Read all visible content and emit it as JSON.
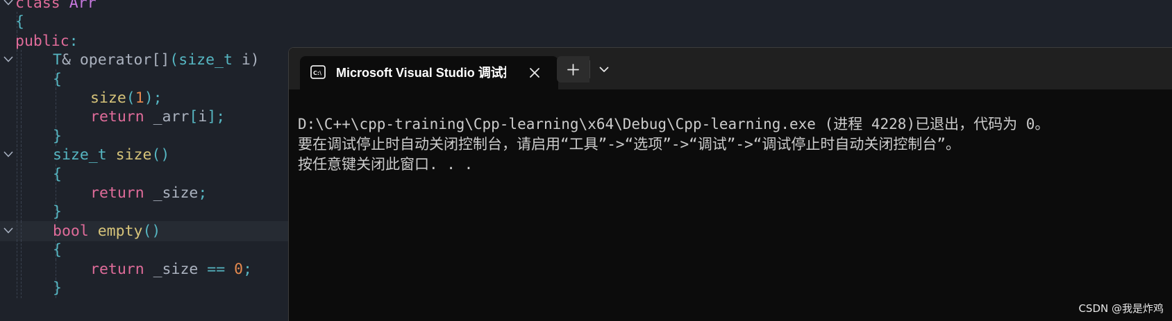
{
  "editor": {
    "lines": [
      {
        "tokens": [
          [
            "class",
            "tok-class"
          ],
          [
            " ",
            ""
          ],
          [
            "Arr",
            "tok-cls-name"
          ]
        ]
      },
      {
        "tokens": [
          [
            "{",
            "tok-punc"
          ]
        ]
      },
      {
        "tokens": [
          [
            "public",
            "tok-kw"
          ],
          [
            ":",
            "tok-punc"
          ]
        ]
      },
      {
        "tokens": [
          [
            "T",
            "tok-type"
          ],
          [
            "& ",
            "tok-plain"
          ],
          [
            "operator",
            "tok-plain"
          ],
          [
            "[]",
            "tok-plain"
          ],
          [
            "(",
            "tok-punc"
          ],
          [
            "size_t",
            "tok-type"
          ],
          [
            " i)",
            "tok-plain"
          ]
        ]
      },
      {
        "tokens": [
          [
            "{",
            "tok-punc"
          ]
        ]
      },
      {
        "tokens": [
          [
            "size",
            "tok-func"
          ],
          [
            "(",
            "tok-punc"
          ],
          [
            "1",
            "tok-num"
          ],
          [
            ");",
            "tok-punc"
          ]
        ]
      },
      {
        "tokens": [
          [
            "return",
            "tok-kw"
          ],
          [
            " _arr",
            "tok-plain"
          ],
          [
            "[",
            "tok-punc"
          ],
          [
            "i",
            "tok-plain"
          ],
          [
            "];",
            "tok-punc"
          ]
        ]
      },
      {
        "tokens": [
          [
            "}",
            "tok-punc"
          ]
        ]
      },
      {
        "tokens": [
          [
            "size_t",
            "tok-type"
          ],
          [
            " ",
            ""
          ],
          [
            "size",
            "tok-func"
          ],
          [
            "()",
            "tok-punc"
          ]
        ]
      },
      {
        "tokens": [
          [
            "{",
            "tok-punc"
          ]
        ]
      },
      {
        "tokens": [
          [
            "return",
            "tok-kw"
          ],
          [
            " _size",
            "tok-plain"
          ],
          [
            ";",
            "tok-punc"
          ]
        ]
      },
      {
        "tokens": [
          [
            "}",
            "tok-punc"
          ]
        ]
      },
      {
        "tokens": [
          [
            "bool",
            "tok-kw"
          ],
          [
            " ",
            ""
          ],
          [
            "empty",
            "tok-func"
          ],
          [
            "()",
            "tok-punc"
          ]
        ]
      },
      {
        "tokens": [
          [
            "{",
            "tok-punc"
          ]
        ]
      },
      {
        "tokens": [
          [
            "return",
            "tok-kw"
          ],
          [
            " _size ",
            "tok-plain"
          ],
          [
            "==",
            "tok-punc"
          ],
          [
            " ",
            ""
          ],
          [
            "0",
            "tok-num"
          ],
          [
            ";",
            "tok-punc"
          ]
        ]
      },
      {
        "tokens": [
          [
            "}",
            "tok-punc"
          ]
        ]
      }
    ]
  },
  "terminal": {
    "tab_title": "Microsoft Visual Studio 调试控",
    "new_tab_icon": "plus-icon",
    "dropdown_icon": "chevron-down-icon",
    "close_icon": "close-icon",
    "console_icon": "console-icon",
    "output": [
      "D:\\C++\\cpp-training\\Cpp-learning\\x64\\Debug\\Cpp-learning.exe (进程 4228)已退出，代码为 0。",
      "要在调试停止时自动关闭控制台，请启用“工具”->“选项”->“调试”->“调试停止时自动关闭控制台”。",
      "按任意键关闭此窗口. . ."
    ]
  },
  "watermark": "CSDN @我是炸鸡"
}
